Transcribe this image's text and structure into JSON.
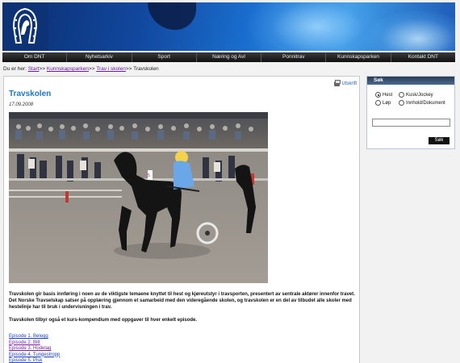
{
  "nav": {
    "items": [
      "Om DNT",
      "Nyhetsarkiv",
      "Sport",
      "Næring og Avl",
      "Ponnitrav",
      "Kunnskapsparken",
      "Kontakt DNT"
    ]
  },
  "breadcrumb": {
    "prefix": "Du er her:",
    "items": [
      "Start",
      "Kunnskapsparken",
      "Trav i skolen",
      "Travskolen"
    ],
    "separator": ">>"
  },
  "article": {
    "print_label": "Utskrift",
    "title": "Travskolen",
    "date": "17.09.2008",
    "paragraph1": "Travskolen gir basis innføring i noen av de viktigste temaene knyttet til hest og kjøreutstyr i travsporten, presentert av sentrale aktører innenfor travet. Det Norske Travselskap satser på opplæring gjennom et samarbeid med den videregående skolen, og travskolen er en del av tilbudet alle skoler med hestelinje har til bruk i undervisningen i trav.",
    "paragraph2": "Travskolen tilbyr også et kurs-kompendium med oppgaver til hver enkelt episode.",
    "episodes": [
      "Episode 1. Belegg",
      "Episode 2. Bitt",
      "Episode 3. Hodelag",
      "Episode 4. Tungestropp",
      "Episode 5. Pisk"
    ]
  },
  "search": {
    "heading": "Søk",
    "options": [
      "Hest",
      "Kusk/Jockey",
      "Løp",
      "Innhold/Dokument"
    ],
    "selected": "Hest",
    "button_label": "Søk"
  }
}
